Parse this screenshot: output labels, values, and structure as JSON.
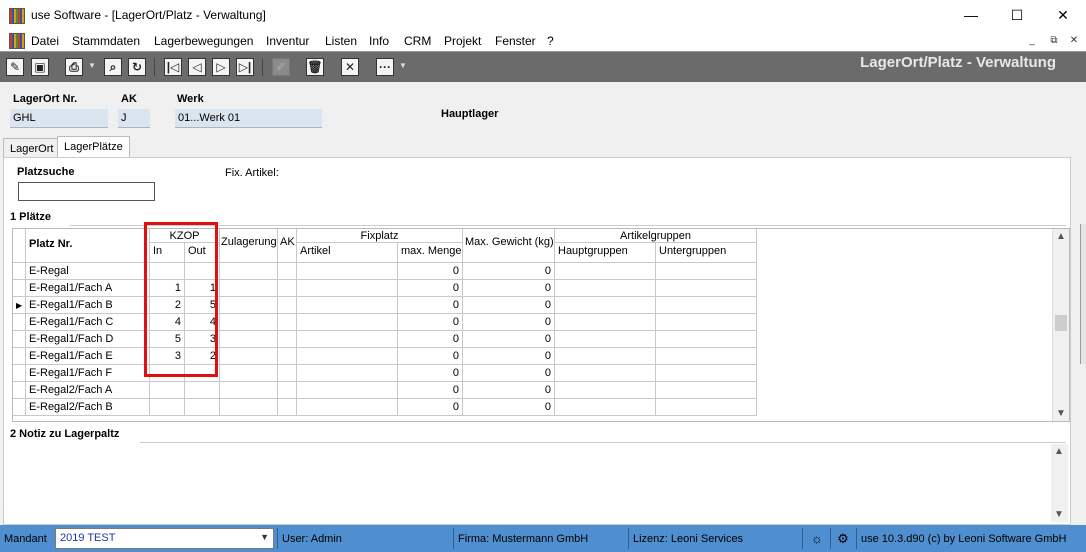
{
  "window": {
    "title": "use Software - [LagerOrt/Platz - Verwaltung]",
    "minimize": "—",
    "maximize": "☐",
    "close": "✕"
  },
  "menu": {
    "items": [
      "Datei",
      "Stammdaten",
      "Lagerbewegungen",
      "Inventur",
      "Listen",
      "Info",
      "CRM",
      "Projekt",
      "Fenster",
      "?"
    ]
  },
  "toolbar": {
    "title": "LagerOrt/Platz - Verwaltung"
  },
  "header": {
    "lagerort_label": "LagerOrt Nr.",
    "lagerort_value": "GHL",
    "ak_label": "AK",
    "ak_value": "J",
    "werk_label": "Werk",
    "werk_value": "01...Werk 01",
    "hauptlager": "Hauptlager"
  },
  "tabs": [
    "LagerOrt",
    "LagerPlätze"
  ],
  "search": {
    "label": "Platzsuche",
    "value": "",
    "fix_artikel_label": "Fix. Artikel:"
  },
  "plaetze": {
    "section_title": "1 Plätze",
    "columns": {
      "platz": "Platz Nr.",
      "kzop": "KZOP",
      "in": "In",
      "out": "Out",
      "zulagerung": "Zulagerung",
      "ak": "AK",
      "fixplatz": "Fixplatz",
      "artikel": "Artikel",
      "max_menge": "max. Menge",
      "max_gewicht": "Max. Gewicht (kg)",
      "artikelgruppen": "Artikelgruppen",
      "hauptgruppen": "Hauptgruppen",
      "untergruppen": "Untergruppen"
    },
    "rows": [
      {
        "platz": "E-Regal",
        "in": "",
        "out": "",
        "max_menge": "0",
        "max_gewicht": "0"
      },
      {
        "platz": "E-Regal1/Fach A",
        "in": "1",
        "out": "1",
        "max_menge": "0",
        "max_gewicht": "0"
      },
      {
        "platz": "E-Regal1/Fach B",
        "in": "2",
        "out": "5",
        "max_menge": "0",
        "max_gewicht": "0"
      },
      {
        "platz": "E-Regal1/Fach C",
        "in": "4",
        "out": "4",
        "max_menge": "0",
        "max_gewicht": "0"
      },
      {
        "platz": "E-Regal1/Fach D",
        "in": "5",
        "out": "3",
        "max_menge": "0",
        "max_gewicht": "0"
      },
      {
        "platz": "E-Regal1/Fach E",
        "in": "3",
        "out": "2",
        "max_menge": "0",
        "max_gewicht": "0"
      },
      {
        "platz": "E-Regal1/Fach F",
        "in": "",
        "out": "",
        "max_menge": "0",
        "max_gewicht": "0"
      },
      {
        "platz": "E-Regal2/Fach A",
        "in": "",
        "out": "",
        "max_menge": "0",
        "max_gewicht": "0"
      },
      {
        "platz": "E-Regal2/Fach B",
        "in": "",
        "out": "",
        "max_menge": "0",
        "max_gewicht": "0"
      }
    ]
  },
  "notiz": {
    "section_title": "2 Notiz zu Lagerpaltz"
  },
  "status": {
    "mandant_label": "Mandant",
    "mandant_value": "2019 TEST",
    "user": "User: Admin",
    "firma": "Firma: Mustermann GmbH",
    "lizenz": "Lizenz: Leoni Services",
    "version": "use 10.3.d90 (c) by Leoni Software GmbH"
  },
  "colors": {
    "toolbar_bg": "#6b6b6b",
    "status_bg": "#4f8fcf",
    "field_bg": "#dbe5ef",
    "highlight_box": "#e01010"
  }
}
